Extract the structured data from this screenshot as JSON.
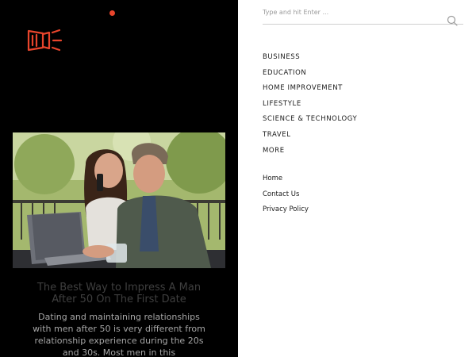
{
  "colors": {
    "accent": "#e8452c",
    "panel_dark": "#000000",
    "panel_light": "#ffffff"
  },
  "header": {
    "menu_indicator": "dot-icon",
    "logo": "megaphone-logo"
  },
  "featured_article": {
    "title": "The Best Way to Impress A Man After 50 On The First Date",
    "excerpt": "Dating and maintaining relationships with men after 50 is very different from relationship experience during the 20s and 30s. Most men in this",
    "image": "couple-at-laptop-photo"
  },
  "search": {
    "placeholder": "Type and hit Enter ...",
    "value": "",
    "icon": "search-icon"
  },
  "categories": [
    "BUSINESS",
    "EDUCATION",
    "HOME IMPROVEMENT",
    "LIFESTYLE",
    "SCIENCE & TECHNOLOGY",
    "TRAVEL",
    "MORE"
  ],
  "pages": [
    "Home",
    "Contact Us",
    "Privacy Policy"
  ]
}
